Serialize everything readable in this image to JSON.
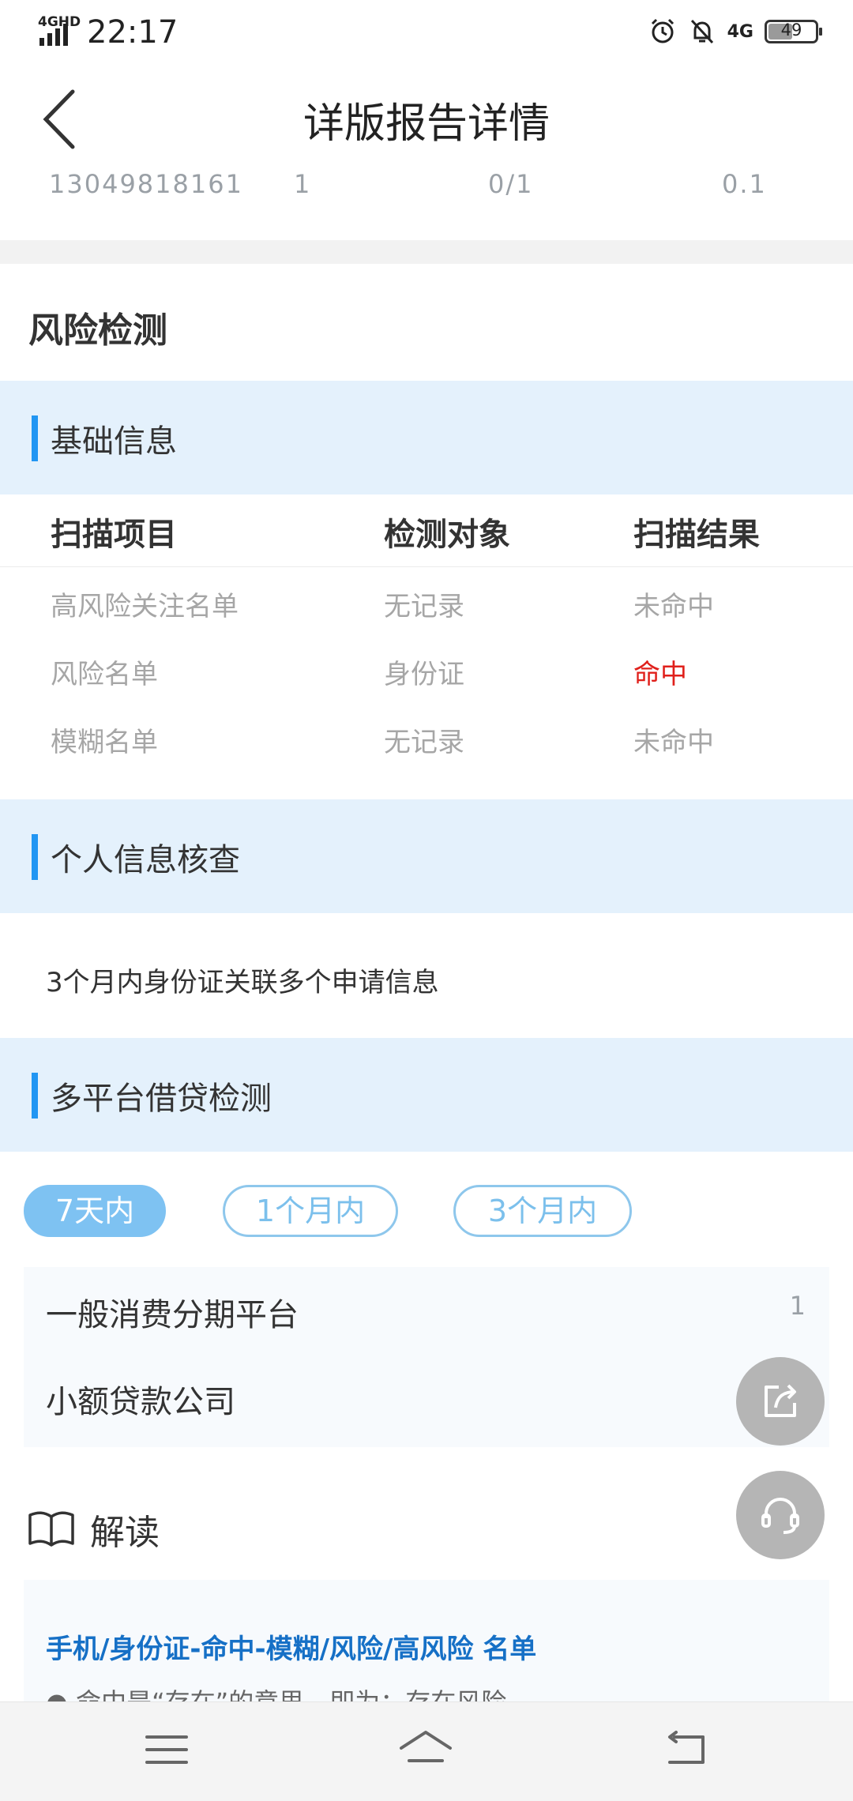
{
  "status_bar": {
    "network": "4GHD",
    "time": "22:17",
    "network_right": "4G",
    "battery": "49",
    "icons": [
      "signal-icon",
      "alarm-icon",
      "mute-bell-icon",
      "battery-icon"
    ]
  },
  "title_bar": {
    "title": "详版报告详情",
    "back_icon": "chevron-left-icon"
  },
  "summary": {
    "phone": "13049818161",
    "count": "1",
    "ratio": "0/1",
    "score": "0.1"
  },
  "risk_section": {
    "heading": "风险检测"
  },
  "basic_info": {
    "title": "基础信息",
    "columns": [
      "扫描项目",
      "检测对象",
      "扫描结果"
    ],
    "rows": [
      {
        "item": "高风险关注名单",
        "target": "无记录",
        "result": "未命中"
      },
      {
        "item": "风险名单",
        "target": "身份证",
        "result": "命中"
      },
      {
        "item": "模糊名单",
        "target": "无记录",
        "result": "未命中"
      }
    ]
  },
  "personal_check": {
    "title": "个人信息核查",
    "text": "3个月内身份证关联多个申请信息"
  },
  "multi_platform": {
    "title": "多平台借贷检测",
    "tabs": [
      "7天内",
      "1个月内",
      "3个月内"
    ],
    "active_tab": "7天内",
    "rows": [
      {
        "name": "一般消费分期平台",
        "count": "1"
      },
      {
        "name": "小额贷款公司",
        "count": ""
      }
    ]
  },
  "interpretation": {
    "title": "解读",
    "icon": "book-icon",
    "heading": "手机/身份证-命中-模糊/风险/高风险 名单",
    "line": "● 命中是“存在”的意思，即为：存在风险"
  },
  "float_buttons": [
    "share-icon",
    "headset-icon"
  ],
  "nav_bar": [
    "menu-icon",
    "home-icon",
    "back-icon"
  ],
  "colors": {
    "accent": "#2196f3",
    "band": "#e4f1fc",
    "hit": "#e0201b",
    "tab_active": "#7ec2f2",
    "link": "#1670c6"
  }
}
